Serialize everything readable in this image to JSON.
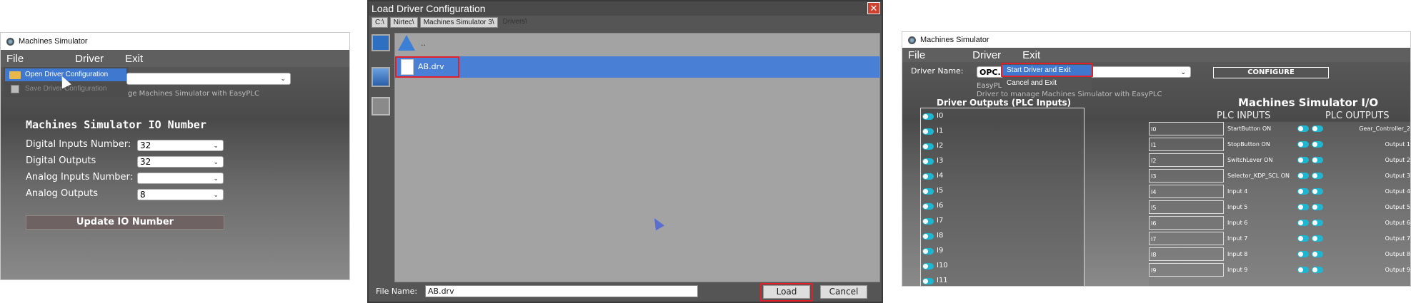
{
  "p1": {
    "window_title": "Machines Simulator",
    "menu": {
      "file": "File",
      "driver": "Driver",
      "exit": "Exit"
    },
    "dropdown": {
      "open": "Open Driver Configuration",
      "save": "Save Driver Configuration"
    },
    "desc_fragment": "ge Machines Simulator with EasyPLC",
    "section_title": "Machines Simulator IO Number",
    "fields": [
      {
        "label": "Digital Inputs Number:",
        "value": "32"
      },
      {
        "label": "Digital Outputs",
        "value": "32"
      },
      {
        "label": "Analog Inputs Number:",
        "value": ""
      },
      {
        "label": "Analog Outputs",
        "value": "8"
      }
    ],
    "update_button": "Update IO Number"
  },
  "p2": {
    "title": "Load Driver Configuration",
    "breadcrumbs": [
      "C:\\",
      "Nirtec\\",
      "Machines Simulator 3\\",
      "Drivers\\"
    ],
    "up_label": "..",
    "file_item": "AB.drv",
    "file_name_label": "File Name:",
    "file_name_value": "AB.drv",
    "load_button": "Load",
    "cancel_button": "Cancel"
  },
  "p3": {
    "window_title": "Machines Simulator",
    "menu": {
      "file": "File",
      "driver": "Driver",
      "exit": "Exit"
    },
    "driver_name_label": "Driver Name:",
    "driver_value": "OPC.",
    "configure_button": "CONFIGURE",
    "exit_menu": {
      "start": "Start Driver and Exit",
      "cancel": "Cancel and Exit"
    },
    "desc_easy": "EasyPL",
    "desc_line": "Driver to manage Machines Simulator with EasyPLC",
    "outputs_title": "Driver Outputs (PLC Inputs)",
    "io_title": "Machines Simulator I/O",
    "plc_inputs": "PLC INPUTS",
    "plc_outputs": "PLC OUTPUTS",
    "driver_outputs": [
      "I0",
      "I1",
      "I2",
      "I3",
      "I4",
      "I5",
      "I6",
      "I7",
      "I8",
      "I9",
      "I10",
      "I11"
    ],
    "io_rows": [
      {
        "n": "I0",
        "in": "StartButton ON",
        "out": "Gear_Controller_2"
      },
      {
        "n": "I1",
        "in": "StopButton ON",
        "out": "Output 1"
      },
      {
        "n": "I2",
        "in": "SwitchLever ON",
        "out": "Output 2"
      },
      {
        "n": "I3",
        "in": "Selector_KDP_SCL ON",
        "out": "Output 3"
      },
      {
        "n": "I4",
        "in": "Input 4",
        "out": "Output 4"
      },
      {
        "n": "I5",
        "in": "Input 5",
        "out": "Output 5"
      },
      {
        "n": "I6",
        "in": "Input 6",
        "out": "Output 6"
      },
      {
        "n": "I7",
        "in": "Input 7",
        "out": "Output 7"
      },
      {
        "n": "I8",
        "in": "Input 8",
        "out": "Output 8"
      },
      {
        "n": "I9",
        "in": "Input 9",
        "out": "Output 9"
      }
    ]
  },
  "colors": {
    "highlight_red": "#e0202a",
    "toggle_cyan": "#1fb6d1",
    "select_blue": "#4a7fd6"
  }
}
